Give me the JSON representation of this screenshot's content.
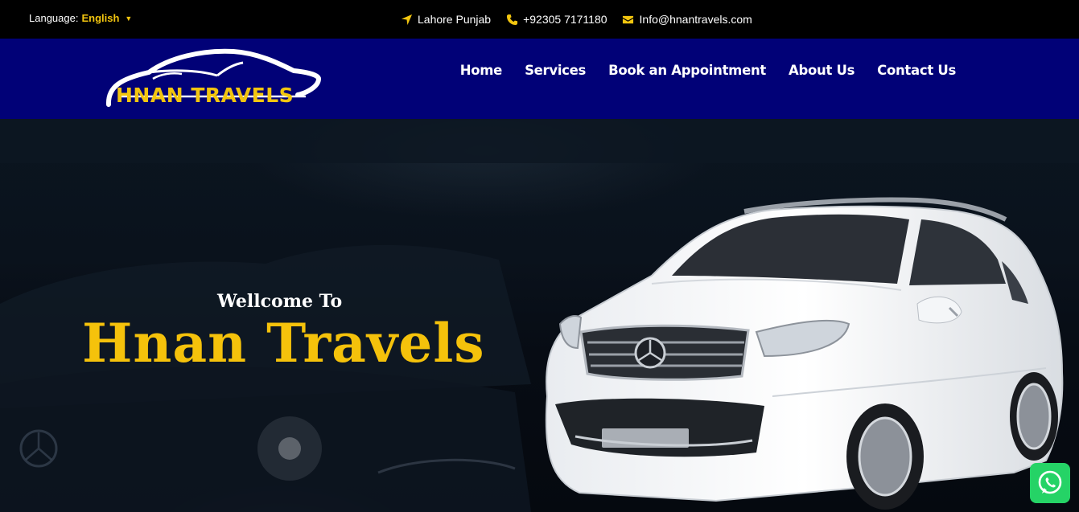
{
  "topbar": {
    "language_label": "Language:",
    "language_value": "English",
    "location": "Lahore Punjab",
    "phone": "+92305 7171180",
    "email": "Info@hnantravels.com"
  },
  "brand": {
    "name": "HNAN TRAVELS",
    "accent_color": "#f2c50f",
    "nav_bg": "#010177"
  },
  "nav": {
    "items": [
      {
        "label": "Home"
      },
      {
        "label": "Services"
      },
      {
        "label": "Book an Appointment"
      },
      {
        "label": "About Us"
      },
      {
        "label": "Contact Us"
      }
    ]
  },
  "hero": {
    "welcome": "Wellcome To",
    "title": "Hnan Travels",
    "image": "white-suv"
  },
  "widgets": {
    "whatsapp_icon": "whatsapp-icon"
  }
}
